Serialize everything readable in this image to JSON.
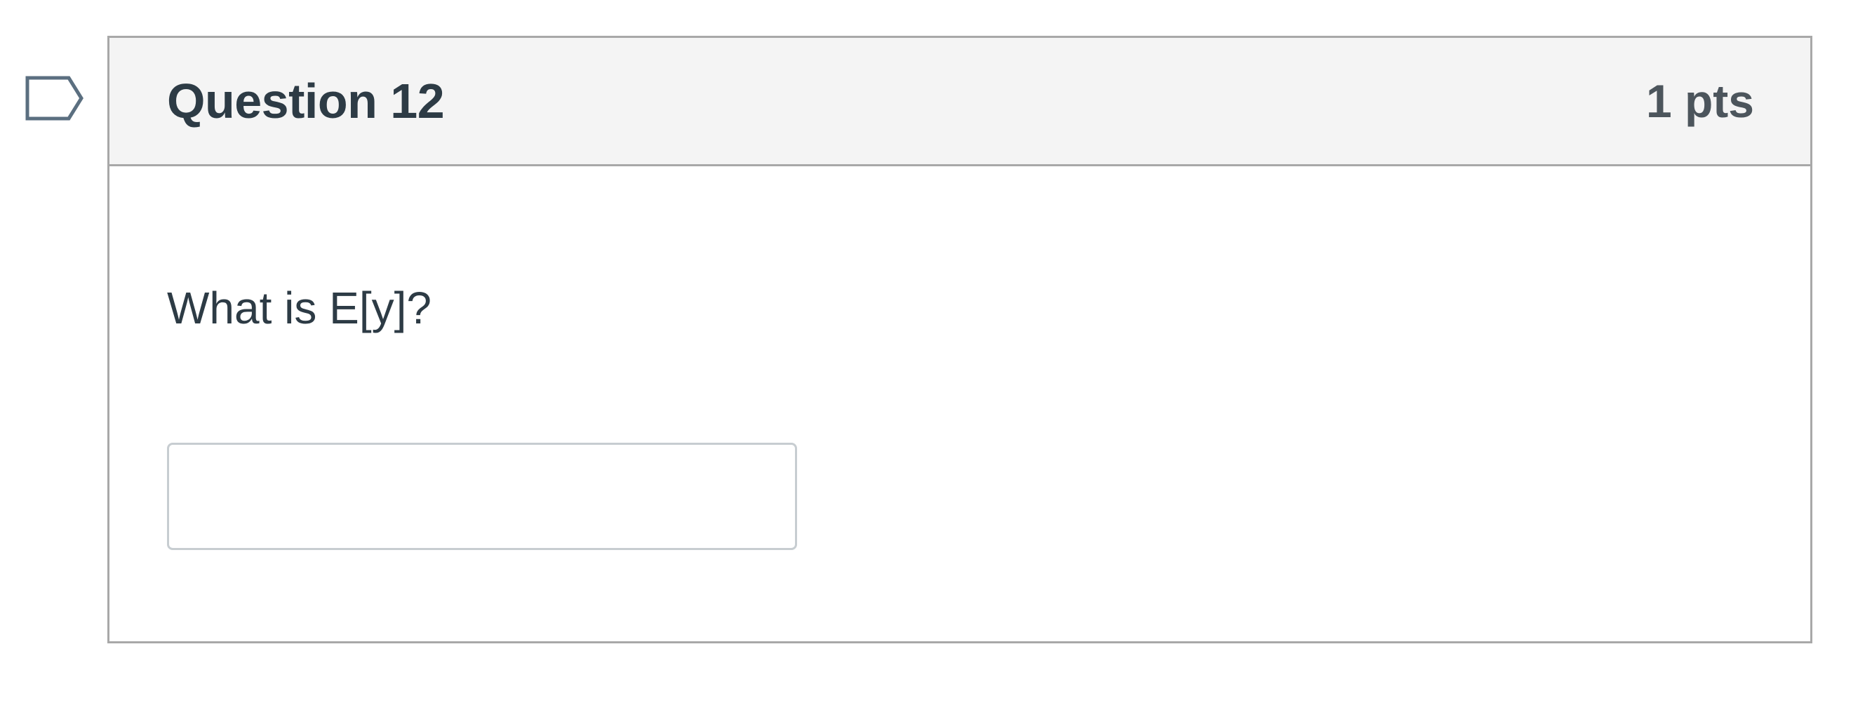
{
  "question": {
    "title": "Question 12",
    "points": "1 pts",
    "text": "What is E[y]?",
    "answer": {
      "value": "",
      "placeholder": ""
    }
  },
  "icons": {
    "flag": "bookmark-flag-icon"
  },
  "colors": {
    "header_bg": "#f4f4f4",
    "border": "#a8a8a8",
    "title_text": "#2d3b45",
    "points_text": "#4c555c",
    "flag_stroke": "#5b6f80"
  }
}
